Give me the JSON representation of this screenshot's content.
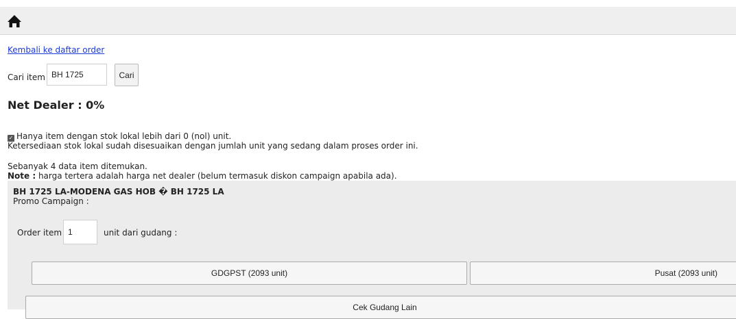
{
  "topbar": {
    "home_icon": "home-icon"
  },
  "back_link": "Kembali ke daftar order",
  "search": {
    "label": "Cari item",
    "value": "BH 1725",
    "button": "Cari"
  },
  "net_dealer": "Net Dealer : 0%",
  "filter": {
    "checked": true,
    "label": "Hanya item dengan stok lokal lebih dari 0 (nol) unit.",
    "stock_note": "Ketersediaan stok lokal sudah disesuaikan dengan jumlah unit yang sedang dalam proses order ini."
  },
  "results": {
    "found_text": "Sebanyak 4 data item ditemukan.",
    "note_label": "Note :",
    "note_text": " harga tertera adalah harga net dealer (belum termasuk diskon campaign apabila ada)."
  },
  "item": {
    "title": "BH 1725 LA-MODENA GAS HOB � BH 1725 LA",
    "promo": "Promo Campaign :",
    "order_label": "Order item",
    "qty": "1",
    "order_suffix": "unit dari gudang :",
    "warehouses": [
      {
        "label": "GDGPST (2093 unit)"
      },
      {
        "label": "Pusat (2093 unit)"
      }
    ],
    "other_button": "Cek Gudang Lain"
  }
}
